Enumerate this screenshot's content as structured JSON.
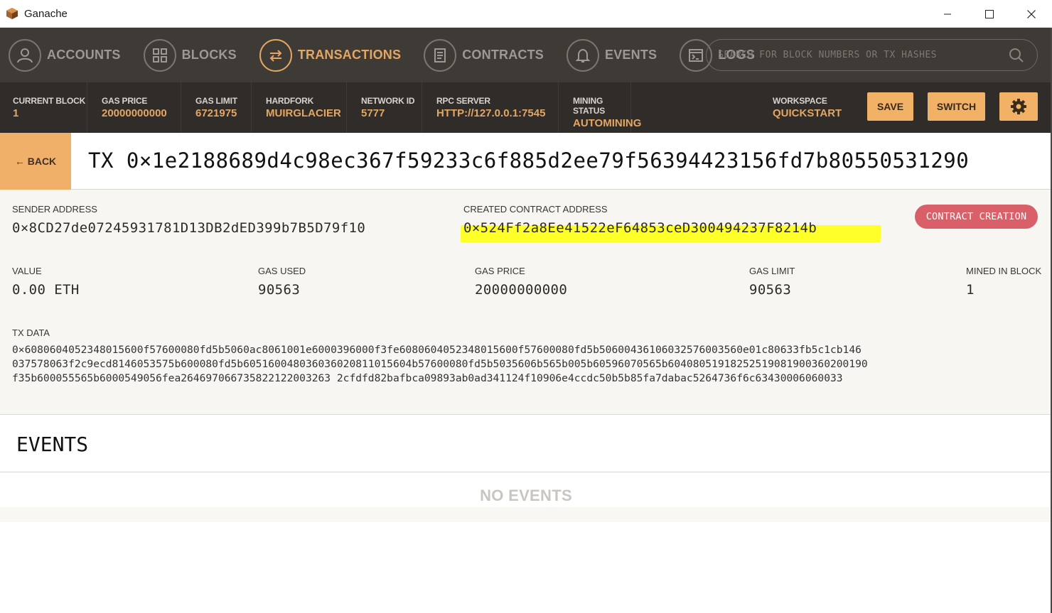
{
  "window": {
    "title": "Ganache"
  },
  "nav": {
    "items": [
      {
        "label": "ACCOUNTS",
        "icon": "account-icon",
        "active": false
      },
      {
        "label": "BLOCKS",
        "icon": "blocks-icon",
        "active": false
      },
      {
        "label": "TRANSACTIONS",
        "icon": "transactions-icon",
        "active": true
      },
      {
        "label": "CONTRACTS",
        "icon": "contracts-icon",
        "active": false
      },
      {
        "label": "EVENTS",
        "icon": "bell-icon",
        "active": false
      },
      {
        "label": "LOGS",
        "icon": "terminal-icon",
        "active": false
      }
    ],
    "search_placeholder": "SEARCH FOR BLOCK NUMBERS OR TX HASHES"
  },
  "stats": {
    "current_block": {
      "label": "CURRENT BLOCK",
      "value": "1"
    },
    "gas_price": {
      "label": "GAS PRICE",
      "value": "20000000000"
    },
    "gas_limit": {
      "label": "GAS LIMIT",
      "value": "6721975"
    },
    "hardfork": {
      "label": "HARDFORK",
      "value": "MUIRGLACIER"
    },
    "network_id": {
      "label": "NETWORK ID",
      "value": "5777"
    },
    "rpc_server": {
      "label": "RPC SERVER",
      "value": "HTTP://127.0.0.1:7545"
    },
    "mining_status": {
      "label": "MINING STATUS",
      "value": "AUTOMINING"
    },
    "workspace": {
      "label": "WORKSPACE",
      "value": "QUICKSTART"
    },
    "save_label": "SAVE",
    "switch_label": "SWITCH"
  },
  "tx": {
    "back_label": "← BACK",
    "title": "TX 0×1e2188689d4c98ec367f59233c6f885d2ee79f56394423156fd7b80550531290",
    "sender_label": "SENDER ADDRESS",
    "sender_value": "0×8CD27de07245931781D13DB2dED399b7B5D79f10",
    "created_label": "CREATED CONTRACT ADDRESS",
    "created_value": "0×524Ff2a8Ee41522eF64853ceD300494237F8214b",
    "badge": "CONTRACT CREATION",
    "value_label": "VALUE",
    "value_value": "0.00 ETH",
    "gas_used_label": "GAS USED",
    "gas_used_value": "90563",
    "gas_price_label": "GAS PRICE",
    "gas_price_value": "20000000000",
    "gas_limit_label": "GAS LIMIT",
    "gas_limit_value": "90563",
    "mined_label": "MINED IN BLOCK",
    "mined_value": "1",
    "data_label": "TX DATA",
    "data_lines": [
      "0×6080604052348015600f57600080fd5b5060ac8061001e6000396000f3fe6080604052348015600f57600080fd5b50600436106032576003560e01c80633fb5c1cb146",
      "037578063f2c9ecd8146053575b600080fd5b605160048036036020811015604b57600080fd5b5035606b565b005b60596070565b60408051918252519081900360200190",
      "f35b600055565b6000549056fea264697066735822122003263 2cfdfd82bafbca09893ab0ad341124f10906e4ccdc50b5b85fa7dabac5264736f6c63430006060033"
    ]
  },
  "events": {
    "title": "EVENTS",
    "empty_label": "NO EVENTS"
  },
  "colors": {
    "accent": "#e4a663",
    "nav_bg": "#3e3a36",
    "stats_bg": "#2f2c29",
    "badge": "#d95f68",
    "highlight": "#ffff29"
  }
}
